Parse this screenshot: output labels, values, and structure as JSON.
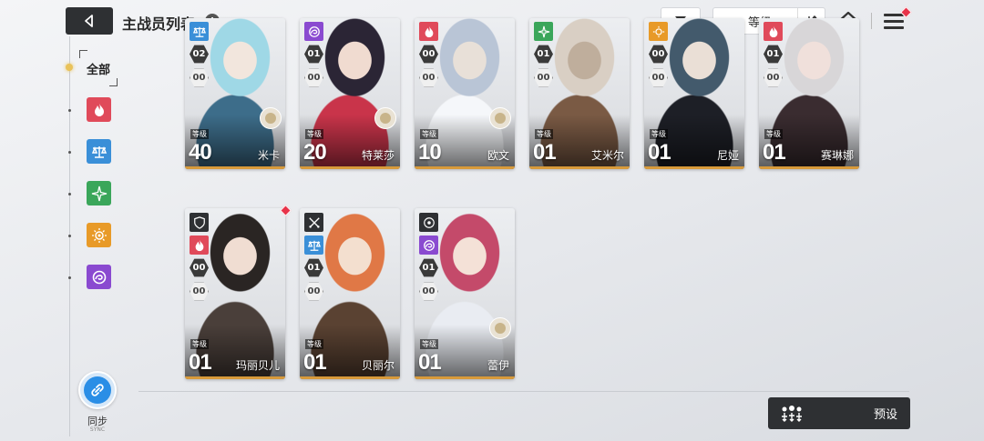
{
  "header": {
    "title": "主战员列表",
    "info_glyph": "i",
    "sort_label": "等级",
    "sort_order_glyph": "↓↑"
  },
  "sidebar": {
    "all_label": "全部",
    "categories": [
      {
        "icon": "flame-icon",
        "color": "#e04a5a"
      },
      {
        "icon": "scale-icon",
        "color": "#3a8fd8"
      },
      {
        "icon": "compass-star-icon",
        "color": "#3aa65a"
      },
      {
        "icon": "sun-icon",
        "color": "#e89a28"
      },
      {
        "icon": "vortex-icon",
        "color": "#8a4ad0"
      }
    ],
    "sync_label": "同步",
    "sync_sub": "SYNC"
  },
  "cards": [
    {
      "name": "米卡",
      "level": "40",
      "level_tag": "等级",
      "badge1": "02",
      "badge2": "00",
      "class_color": "#3a8fd8",
      "class_icon": "scale-icon",
      "companion": true
    },
    {
      "name": "特莱莎",
      "level": "20",
      "level_tag": "等级",
      "badge1": "01",
      "badge2": "00",
      "class_color": "#8a4ad0",
      "class_icon": "vortex-icon",
      "companion": true
    },
    {
      "name": "欧文",
      "level": "10",
      "level_tag": "等级",
      "badge1": "00",
      "badge2": "00",
      "class_color": "#e04a5a",
      "class_icon": "flame-icon",
      "companion": true
    },
    {
      "name": "艾米尔",
      "level": "01",
      "level_tag": "等级",
      "badge1": "01",
      "badge2": "00",
      "class_color": "#3aa65a",
      "class_icon": "compass-star-icon",
      "companion": false
    },
    {
      "name": "尼娅",
      "level": "01",
      "level_tag": "等级",
      "badge1": "00",
      "badge2": "00",
      "class_color": "#e89a28",
      "class_icon": "sun-icon",
      "companion": false
    },
    {
      "name": "赛琳娜",
      "level": "01",
      "level_tag": "等级",
      "badge1": "01",
      "badge2": "00",
      "class_color": "#e04a5a",
      "class_icon": "flame-icon",
      "companion": false
    },
    {
      "name": "玛丽贝儿",
      "level": "01",
      "level_tag": "等级",
      "badge1": "00",
      "badge2": "00",
      "class_color": "#e04a5a",
      "class_icon": "flame-icon",
      "role_icon": "shield-icon",
      "companion": false
    },
    {
      "name": "贝丽尔",
      "level": "01",
      "level_tag": "等级",
      "badge1": "01",
      "badge2": "00",
      "class_color": "#3a8fd8",
      "class_icon": "scale-icon",
      "role_icon": "crossed-swords-icon",
      "companion": false
    },
    {
      "name": "蕾伊",
      "level": "01",
      "level_tag": "等级",
      "badge1": "01",
      "badge2": "00",
      "class_color": "#8a4ad0",
      "class_icon": "vortex-icon",
      "role_icon": "target-icon",
      "companion": true
    }
  ],
  "footer": {
    "preset_label": "预设"
  },
  "colors": {
    "accent_dark": "#2e3033",
    "notify_red": "#e8344a",
    "card_gold": "#d89a3a"
  }
}
